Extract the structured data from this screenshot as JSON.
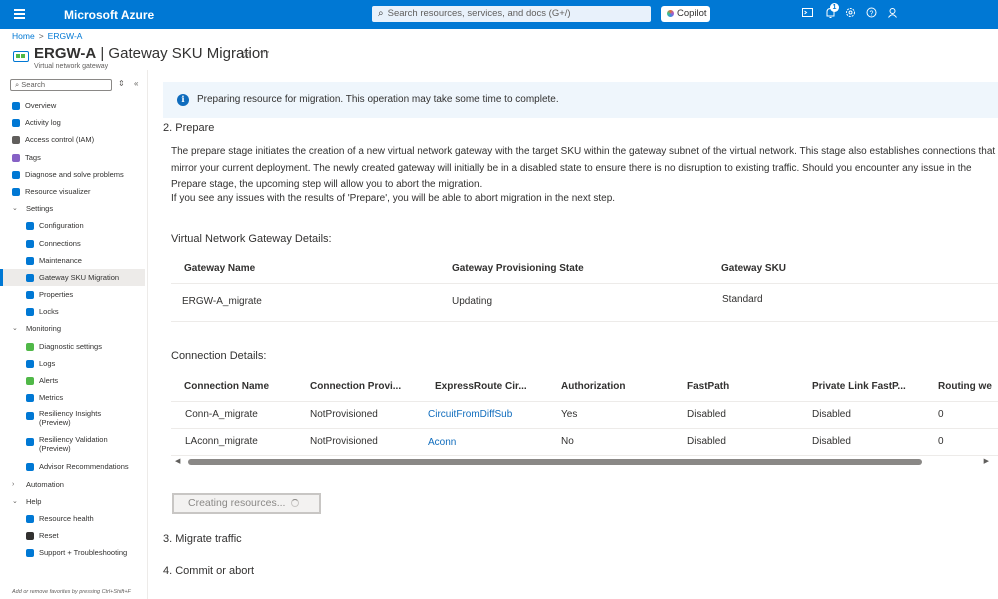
{
  "topbar": {
    "brand": "Microsoft Azure",
    "search_placeholder": "Search resources, services, and docs (G+/)",
    "copilot_label": "Copilot",
    "notification_count": "1",
    "icons": [
      "menu-icon",
      "search-icon",
      "cloud-shell-icon",
      "notifications-icon",
      "settings-icon",
      "help-icon",
      "feedback-icon"
    ]
  },
  "breadcrumb": {
    "home": "Home",
    "current": "ERGW-A"
  },
  "header": {
    "title_bold": "ERGW-A",
    "title_rest": " | Gateway SKU Migration",
    "subtitle": "Virtual network gateway"
  },
  "sidebar": {
    "search_placeholder": "Search",
    "items": [
      {
        "label": "Overview",
        "icon": "overview-icon",
        "color": "#0078d4",
        "indent": 0
      },
      {
        "label": "Activity log",
        "icon": "activity-log-icon",
        "color": "#0078d4",
        "indent": 0
      },
      {
        "label": "Access control (IAM)",
        "icon": "iam-icon",
        "color": "#605e5c",
        "indent": 0
      },
      {
        "label": "Tags",
        "icon": "tag-icon",
        "color": "#8661c5",
        "indent": 0
      },
      {
        "label": "Diagnose and solve problems",
        "icon": "wrench-icon",
        "color": "#0078d4",
        "indent": 0
      },
      {
        "label": "Resource visualizer",
        "icon": "visualizer-icon",
        "color": "#0078d4",
        "indent": 0
      },
      {
        "label": "Settings",
        "icon": "chevron-down-icon",
        "group": true,
        "indent": 0
      },
      {
        "label": "Configuration",
        "icon": "configuration-icon",
        "color": "#0078d4",
        "indent": 1
      },
      {
        "label": "Connections",
        "icon": "connections-icon",
        "color": "#0078d4",
        "indent": 1
      },
      {
        "label": "Maintenance",
        "icon": "maintenance-icon",
        "color": "#0078d4",
        "indent": 1
      },
      {
        "label": "Gateway SKU Migration",
        "icon": "migration-icon",
        "color": "#0078d4",
        "indent": 1,
        "active": true
      },
      {
        "label": "Properties",
        "icon": "properties-icon",
        "color": "#0078d4",
        "indent": 1
      },
      {
        "label": "Locks",
        "icon": "lock-icon",
        "color": "#0078d4",
        "indent": 1
      },
      {
        "label": "Monitoring",
        "icon": "chevron-down-icon",
        "group": true,
        "indent": 0
      },
      {
        "label": "Diagnostic settings",
        "icon": "diagnostic-icon",
        "color": "#50b848",
        "indent": 1
      },
      {
        "label": "Logs",
        "icon": "logs-icon",
        "color": "#0078d4",
        "indent": 1
      },
      {
        "label": "Alerts",
        "icon": "alerts-icon",
        "color": "#50b848",
        "indent": 1
      },
      {
        "label": "Metrics",
        "icon": "metrics-icon",
        "color": "#0078d4",
        "indent": 1
      },
      {
        "label": "Resiliency Insights",
        "label2": "(Preview)",
        "icon": "resiliency-icon",
        "color": "#0078d4",
        "indent": 1
      },
      {
        "label": "Resiliency Validation",
        "label2": "(Preview)",
        "icon": "validation-icon",
        "color": "#0078d4",
        "indent": 1
      },
      {
        "label": "Advisor Recommendations",
        "icon": "advisor-icon",
        "color": "#0078d4",
        "indent": 1
      },
      {
        "label": "Automation",
        "icon": "chevron-right-icon",
        "group": true,
        "collapsed": true,
        "indent": 0
      },
      {
        "label": "Help",
        "icon": "chevron-down-icon",
        "group": true,
        "indent": 0
      },
      {
        "label": "Resource health",
        "icon": "health-icon",
        "color": "#0078d4",
        "indent": 1
      },
      {
        "label": "Reset",
        "icon": "reset-icon",
        "color": "#323130",
        "indent": 1
      },
      {
        "label": "Support + Troubleshooting",
        "icon": "support-icon",
        "color": "#0078d4",
        "indent": 1
      }
    ],
    "footer": "Add or remove favorites by pressing Ctrl+Shift+F"
  },
  "info_bar": {
    "text": "Preparing resource for migration. This operation may take some time to complete."
  },
  "steps": {
    "prepare_title": "2. Prepare",
    "prepare_p1": "The prepare stage initiates the creation of a new virtual network gateway with the target SKU within the gateway subnet of the virtual network. This stage also establishes connections that mirror your current deployment. The newly created gateway will initially be in a disabled state to ensure there is no disruption to existing traffic. Should you encounter any issue in the Prepare stage, the upcoming step will allow you to abort the migration.",
    "prepare_p2": "If you see any issues with the results of 'Prepare', you will be able to abort migration in the next step.",
    "migrate_title": "3. Migrate traffic",
    "commit_title": "4. Commit or abort"
  },
  "gateway_details": {
    "title": "Virtual Network Gateway Details:",
    "columns": [
      "Gateway Name",
      "Gateway Provisioning State",
      "Gateway SKU"
    ],
    "rows": [
      [
        "ERGW-A_migrate",
        "Updating",
        "Standard"
      ]
    ]
  },
  "connection_details": {
    "title": "Connection Details:",
    "columns": [
      "Connection Name",
      "Connection Provi...",
      "ExpressRoute Cir...",
      "Authorization",
      "FastPath",
      "Private Link FastP...",
      "Routing we"
    ],
    "rows": [
      [
        "Conn-A_migrate",
        "NotProvisioned",
        "CircuitFromDiffSub",
        "Yes",
        "Disabled",
        "Disabled",
        "0"
      ],
      [
        "LAconn_migrate",
        "NotProvisioned",
        "Aconn",
        "No",
        "Disabled",
        "Disabled",
        "0"
      ]
    ]
  },
  "action_button": {
    "label": "Creating resources..."
  }
}
